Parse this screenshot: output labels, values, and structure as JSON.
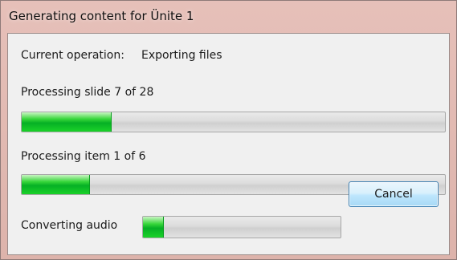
{
  "window": {
    "title": "Generating content for Ünite 1"
  },
  "operation": {
    "label": "Current operation:",
    "value": "Exporting files"
  },
  "slides": {
    "label": "Processing slide 7 of 28",
    "progress_fraction": 0.21
  },
  "items": {
    "label": "Processing item 1 of 6",
    "progress_fraction": 0.16
  },
  "audio": {
    "label": "Converting audio",
    "progress_fraction": 0.1
  },
  "buttons": {
    "cancel_label": "Cancel"
  },
  "colors": {
    "progress_fill": "#06b025",
    "progress_track": "#dcdcdc",
    "button_border": "#3c7fb1"
  }
}
